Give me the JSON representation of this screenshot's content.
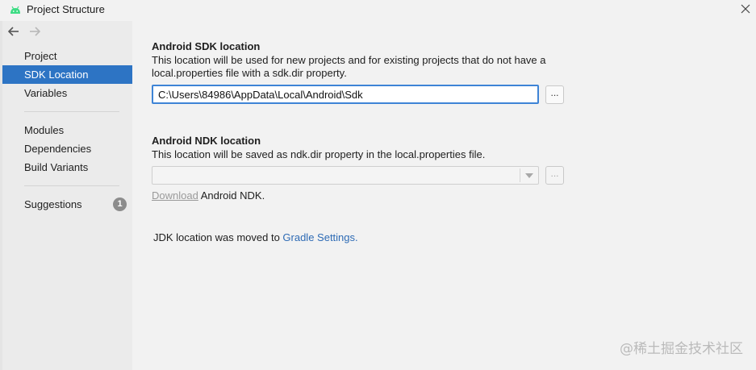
{
  "window": {
    "title": "Project Structure",
    "icon": "android-icon",
    "close_icon": "close-icon"
  },
  "nav": {
    "back_icon": "arrow-left-icon",
    "forward_icon": "arrow-right-icon"
  },
  "sidebar": {
    "items": [
      {
        "label": "Project"
      },
      {
        "label": "SDK Location",
        "selected": true
      },
      {
        "label": "Variables"
      },
      {
        "label": "Modules"
      },
      {
        "label": "Dependencies"
      },
      {
        "label": "Build Variants"
      },
      {
        "label": "Suggestions",
        "badge": "1"
      }
    ],
    "accent": "#2d74c4"
  },
  "sdk": {
    "title": "Android SDK location",
    "desc_line1": "This location will be used for new projects and for existing projects that do not have a",
    "desc_line2": "local.properties file with a sdk.dir property.",
    "path": "C:\\Users\\84986\\AppData\\Local\\Android\\Sdk",
    "browse_label": "..."
  },
  "ndk": {
    "title": "Android NDK location",
    "desc": "This location will be saved as ndk.dir property in the local.properties file.",
    "value": "",
    "browse_label": "...",
    "download_link": "Download",
    "download_suffix": " Android NDK."
  },
  "jdk": {
    "text": "JDK location was moved to ",
    "link": "Gradle Settings."
  },
  "watermark": "@稀土掘金技术社区"
}
